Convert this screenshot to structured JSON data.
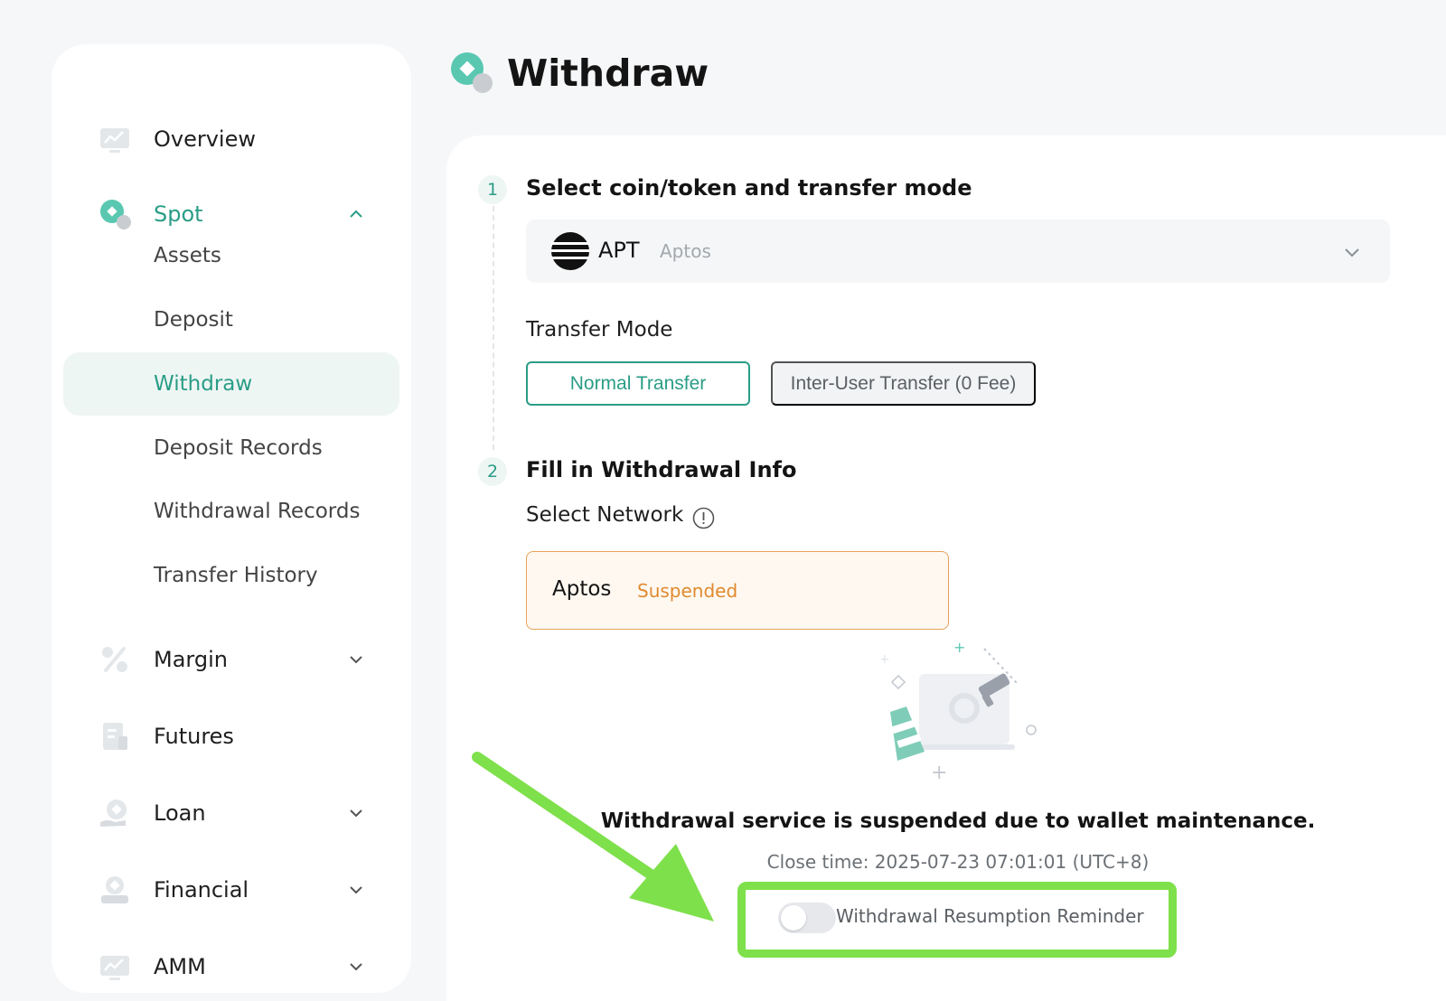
{
  "colors": {
    "accent": "#2a9d86",
    "warning": "#e08a2e",
    "highlight": "#7ee04a"
  },
  "sidebar": {
    "items": [
      {
        "label": "Overview",
        "icon": "chart-screen-icon"
      },
      {
        "label": "Spot",
        "icon": "spot-coin-icon",
        "expanded": true,
        "children": [
          "Assets",
          "Deposit",
          "Withdraw",
          "Deposit Records",
          "Withdrawal Records",
          "Transfer History"
        ],
        "active_child": "Withdraw"
      },
      {
        "label": "Margin",
        "icon": "percent-icon"
      },
      {
        "label": "Futures",
        "icon": "document-icon"
      },
      {
        "label": "Loan",
        "icon": "loan-icon"
      },
      {
        "label": "Financial",
        "icon": "financial-icon"
      },
      {
        "label": "AMM",
        "icon": "amm-icon"
      }
    ]
  },
  "header": {
    "title": "Withdraw"
  },
  "step1": {
    "number": "1",
    "title": "Select coin/token and transfer mode",
    "coin": {
      "symbol": "APT",
      "name": "Aptos"
    },
    "transfer_mode_label": "Transfer Mode",
    "modes": {
      "normal": "Normal Transfer",
      "inter": "Inter-User Transfer (0 Fee)"
    },
    "selected_mode": "Normal Transfer"
  },
  "step2": {
    "number": "2",
    "title": "Fill in Withdrawal Info",
    "network_label": "Select Network",
    "network": {
      "name": "Aptos",
      "status": "Suspended"
    }
  },
  "maintenance": {
    "message": "Withdrawal service is suspended due to wallet maintenance.",
    "close_time": "Close time: 2025-07-23 07:01:01 (UTC+8)",
    "reminder_label": "Withdrawal Resumption Reminder",
    "reminder_on": false
  }
}
